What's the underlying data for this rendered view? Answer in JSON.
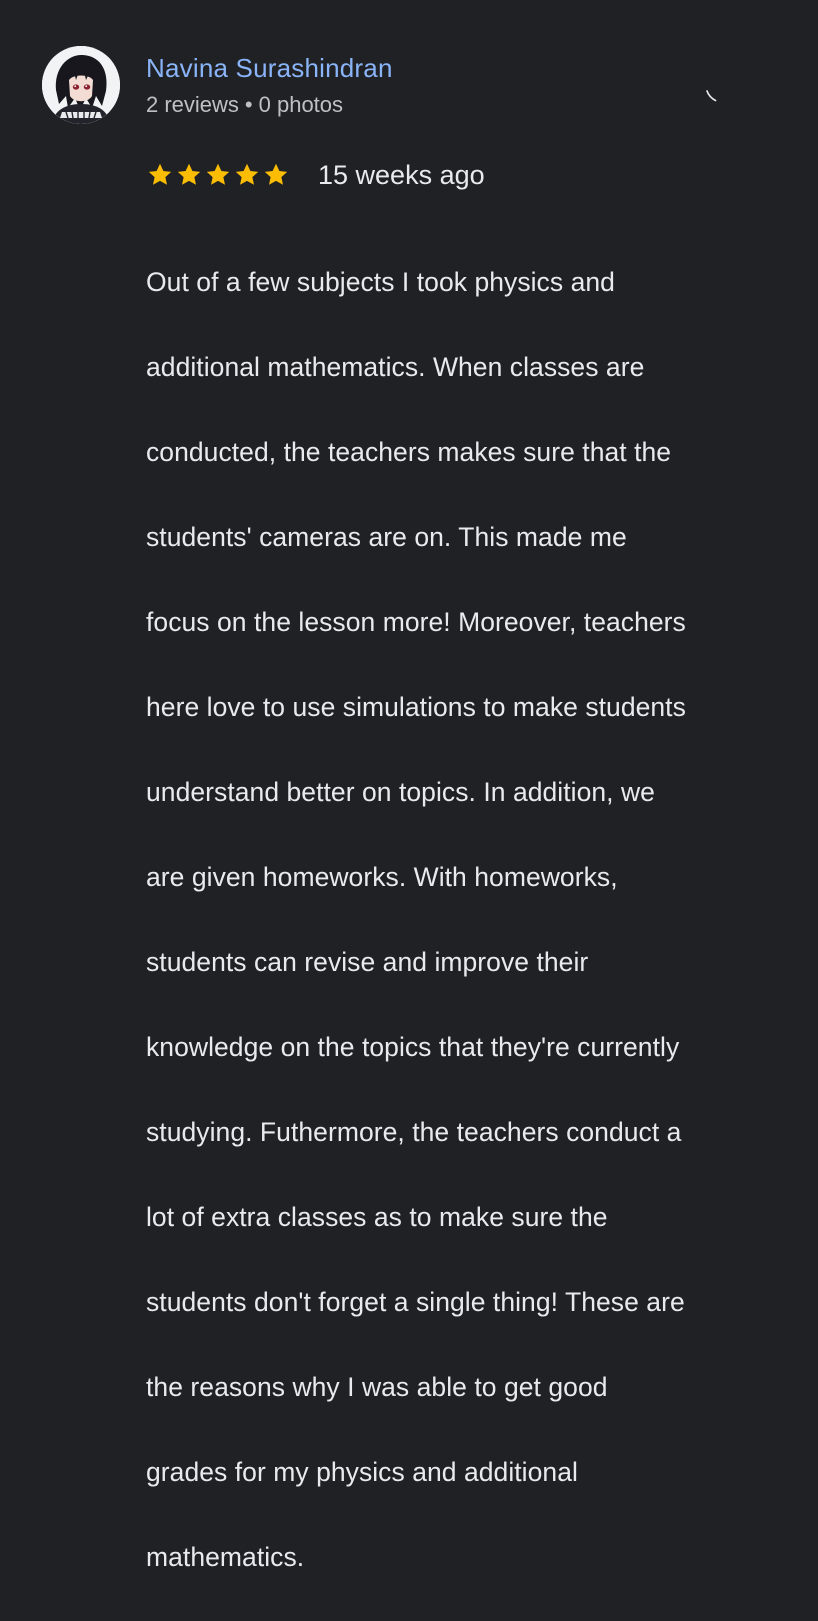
{
  "review": {
    "reviewer": {
      "name": "Navina Surashindran",
      "reviews_count": "2 reviews",
      "separator": "•",
      "photos_count": "0 photos",
      "avatar_icon": "anime-character-avatar"
    },
    "rating": {
      "stars": 5,
      "max": 5,
      "star_icon": "star-icon",
      "star_color": "#fbbc04"
    },
    "time_ago": "15 weeks ago",
    "text_lines": [
      "Out of a few subjects I took physics and",
      "additional mathematics. When classes are",
      "conducted, the teachers makes sure that the",
      "students' cameras are on. This made me",
      "focus on the lesson more! Moreover, teachers",
      "here love to use simulations to make students",
      "understand better on topics. In addition, we",
      "are given homeworks. With homeworks,",
      "students can revise and improve their",
      "knowledge on the topics that they're currently",
      "studying. Futhermore, the teachers conduct a",
      "lot of extra classes as to make sure the",
      "students don't forget a single thing! These are",
      "the reasons why I was able to get good",
      "grades for my physics and additional",
      "mathematics."
    ]
  },
  "colors": {
    "background": "#202124",
    "name": "#8ab4f8",
    "meta": "#bdc1c6",
    "text": "#e8eaed"
  },
  "icons": {
    "more": "more-options-icon"
  }
}
